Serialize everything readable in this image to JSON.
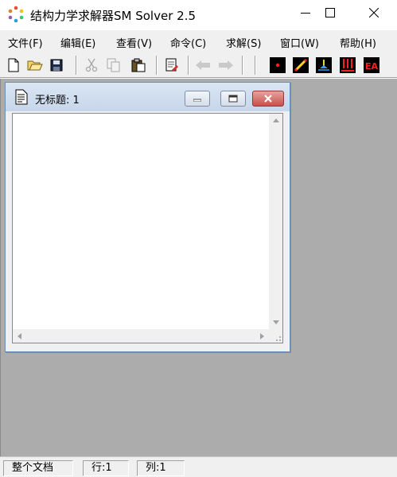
{
  "app": {
    "title": "结构力学求解器SM Solver 2.5"
  },
  "menu": {
    "items": [
      {
        "label": "文件(F)"
      },
      {
        "label": "编辑(E)"
      },
      {
        "label": "查看(V)"
      },
      {
        "label": "命令(C)"
      },
      {
        "label": "求解(S)"
      },
      {
        "label": "窗口(W)"
      },
      {
        "label": "帮助(H)"
      }
    ]
  },
  "toolbar": {
    "buttons": [
      {
        "icon": "new-file-icon",
        "enabled": true
      },
      {
        "icon": "open-folder-icon",
        "enabled": true
      },
      {
        "icon": "save-icon",
        "enabled": true
      },
      {
        "icon": "cut-icon",
        "enabled": false
      },
      {
        "icon": "copy-icon",
        "enabled": false
      },
      {
        "icon": "paste-icon",
        "enabled": true
      },
      {
        "icon": "edit-doc-icon",
        "enabled": true
      },
      {
        "icon": "arrow-left-icon",
        "enabled": false
      },
      {
        "icon": "arrow-right-icon",
        "enabled": false
      },
      {
        "icon": "node-icon",
        "enabled": true
      },
      {
        "icon": "element-icon",
        "enabled": true
      },
      {
        "icon": "support-icon",
        "enabled": true
      },
      {
        "icon": "load-icon",
        "enabled": true
      },
      {
        "icon": "ea-icon",
        "enabled": true,
        "label": "EA"
      }
    ]
  },
  "child_window": {
    "title": "无标题: 1",
    "content": ""
  },
  "statusbar": {
    "mode": "整个文档",
    "line": "行:1",
    "column": "列:1"
  },
  "colors": {
    "mdi_background": "#acacac",
    "menubar": "#f0f0f0",
    "close_button": "#c75050",
    "toolbar_red_icons": "#d00000"
  }
}
